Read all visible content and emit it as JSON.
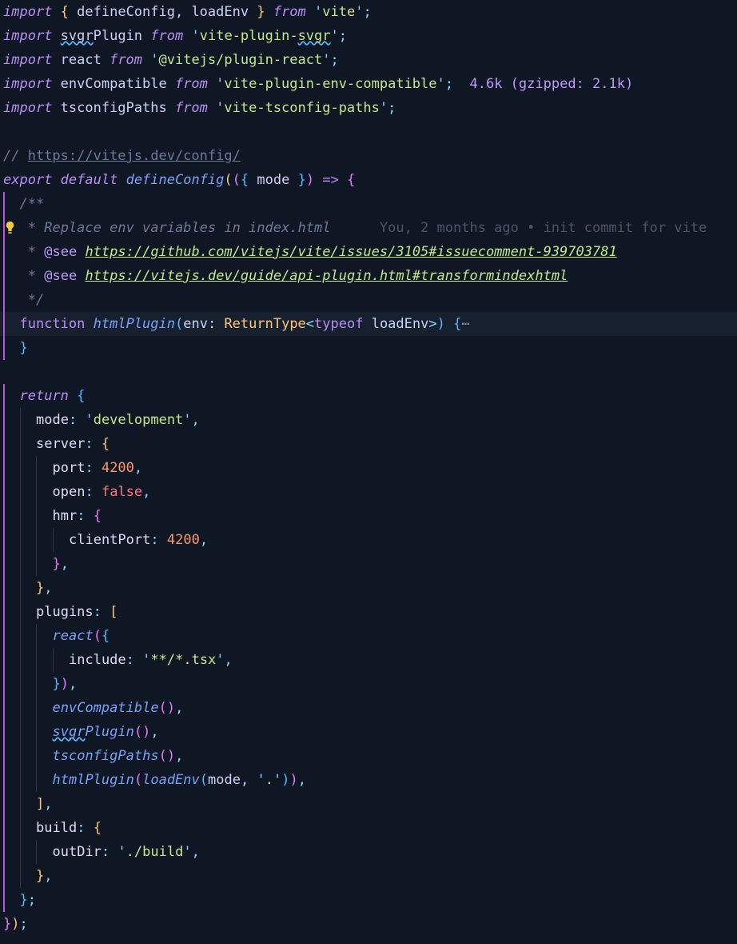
{
  "editor": {
    "lines": [
      [
        [
          "kw",
          "import"
        ],
        [
          "id",
          " "
        ],
        [
          "br1",
          "{"
        ],
        [
          "id",
          " defineConfig, loadEnv "
        ],
        [
          "br1",
          "}"
        ],
        [
          "id",
          " "
        ],
        [
          "kw",
          "from"
        ],
        [
          "id",
          " "
        ],
        [
          "strq",
          "'"
        ],
        [
          "str",
          "vite"
        ],
        [
          "strq",
          "'"
        ],
        [
          "punc",
          ";"
        ]
      ],
      [
        [
          "kw",
          "import"
        ],
        [
          "id",
          " "
        ],
        [
          "id:squig",
          "svgr"
        ],
        [
          "id",
          "Plugin "
        ],
        [
          "kw",
          "from"
        ],
        [
          "id",
          " "
        ],
        [
          "strq",
          "'"
        ],
        [
          "str",
          "vite-plugin-"
        ],
        [
          "str:squig",
          "svgr"
        ],
        [
          "strq",
          "'"
        ],
        [
          "punc",
          ";"
        ]
      ],
      [
        [
          "kw",
          "import"
        ],
        [
          "id",
          " react "
        ],
        [
          "kw",
          "from"
        ],
        [
          "id",
          " "
        ],
        [
          "strq",
          "'"
        ],
        [
          "str",
          "@vitejs/plugin-react"
        ],
        [
          "strq",
          "'"
        ],
        [
          "punc",
          ";"
        ]
      ],
      [
        [
          "kw",
          "import"
        ],
        [
          "id",
          " envCompatible "
        ],
        [
          "kw",
          "from"
        ],
        [
          "id",
          " "
        ],
        [
          "strq",
          "'"
        ],
        [
          "str",
          "vite-plugin-env-compatible"
        ],
        [
          "strq",
          "'"
        ],
        [
          "punc",
          ";"
        ],
        [
          "id",
          "  "
        ],
        [
          "hint",
          "4.6k (gzipped: 2.1k)"
        ]
      ],
      [
        [
          "kw",
          "import"
        ],
        [
          "id",
          " tsconfigPaths "
        ],
        [
          "kw",
          "from"
        ],
        [
          "id",
          " "
        ],
        [
          "strq",
          "'"
        ],
        [
          "str",
          "vite-tsconfig-paths"
        ],
        [
          "strq",
          "'"
        ],
        [
          "punc",
          ";"
        ]
      ],
      [],
      [
        [
          "cmt",
          "// "
        ],
        [
          "lnk",
          "https://vitejs.dev/config/"
        ]
      ],
      [
        [
          "kw",
          "export"
        ],
        [
          "id",
          " "
        ],
        [
          "kw",
          "default"
        ],
        [
          "id",
          " "
        ],
        [
          "fn",
          "defineConfig"
        ],
        [
          "br1",
          "("
        ],
        [
          "br2",
          "("
        ],
        [
          "br3",
          "{"
        ],
        [
          "id",
          " mode "
        ],
        [
          "br3",
          "}"
        ],
        [
          "br2",
          ")"
        ],
        [
          "id",
          " "
        ],
        [
          "kwn",
          "=>"
        ],
        [
          "id",
          " "
        ],
        [
          "br2",
          "{"
        ]
      ],
      [
        [
          "cmt",
          "/**"
        ]
      ],
      [
        [
          "cmt",
          "* Replace env variables in index.html"
        ],
        [
          "id",
          "      "
        ],
        [
          "blame",
          "You, 2 months ago • init commit for vite"
        ]
      ],
      [
        [
          "cmt",
          "* "
        ],
        [
          "tag",
          "@see"
        ],
        [
          "id",
          " "
        ],
        [
          "url",
          "https://github.com/vitejs/vite/issues/3105#issuecomment-939703781"
        ]
      ],
      [
        [
          "cmt",
          "* "
        ],
        [
          "tag",
          "@see"
        ],
        [
          "id",
          " "
        ],
        [
          "url",
          "https://vitejs.dev/guide/api-plugin.html#transformindexhtml"
        ]
      ],
      [
        [
          "cmt",
          "*/"
        ]
      ],
      [
        [
          "kwn",
          "function"
        ],
        [
          "id",
          " "
        ],
        [
          "fn",
          "htmlPlugin"
        ],
        [
          "br3",
          "("
        ],
        [
          "id",
          "env: "
        ],
        [
          "type",
          "ReturnType"
        ],
        [
          "punc",
          "<"
        ],
        [
          "kwn",
          "typeof"
        ],
        [
          "id",
          " loadEnv"
        ],
        [
          "punc",
          ">"
        ],
        [
          "br3",
          ")"
        ],
        [
          "id",
          " "
        ],
        [
          "br3",
          "{"
        ],
        [
          "fold",
          "⋯"
        ]
      ],
      [
        [
          "br3",
          "}"
        ]
      ],
      [],
      [
        [
          "kw",
          "return"
        ],
        [
          "id",
          " "
        ],
        [
          "br3",
          "{"
        ]
      ],
      [
        [
          "prop",
          "mode"
        ],
        [
          "punc",
          ":"
        ],
        [
          "id",
          " "
        ],
        [
          "strq",
          "'"
        ],
        [
          "str",
          "development"
        ],
        [
          "strq",
          "'"
        ],
        [
          "punc",
          ","
        ]
      ],
      [
        [
          "prop",
          "server"
        ],
        [
          "punc",
          ":"
        ],
        [
          "id",
          " "
        ],
        [
          "br1",
          "{"
        ]
      ],
      [
        [
          "prop",
          "port"
        ],
        [
          "punc",
          ":"
        ],
        [
          "id",
          " "
        ],
        [
          "num",
          "4200"
        ],
        [
          "punc",
          ","
        ]
      ],
      [
        [
          "prop",
          "open"
        ],
        [
          "punc",
          ":"
        ],
        [
          "id",
          " "
        ],
        [
          "bool",
          "false"
        ],
        [
          "punc",
          ","
        ]
      ],
      [
        [
          "prop",
          "hmr"
        ],
        [
          "punc",
          ":"
        ],
        [
          "id",
          " "
        ],
        [
          "br2",
          "{"
        ]
      ],
      [
        [
          "prop",
          "clientPort"
        ],
        [
          "punc",
          ":"
        ],
        [
          "id",
          " "
        ],
        [
          "num",
          "4200"
        ],
        [
          "punc",
          ","
        ]
      ],
      [
        [
          "br2",
          "}"
        ],
        [
          "punc",
          ","
        ]
      ],
      [
        [
          "br1",
          "}"
        ],
        [
          "punc",
          ","
        ]
      ],
      [
        [
          "prop",
          "plugins"
        ],
        [
          "punc",
          ":"
        ],
        [
          "id",
          " "
        ],
        [
          "br1",
          "["
        ]
      ],
      [
        [
          "fn",
          "react"
        ],
        [
          "br2",
          "("
        ],
        [
          "br3",
          "{"
        ]
      ],
      [
        [
          "prop",
          "include"
        ],
        [
          "punc",
          ":"
        ],
        [
          "id",
          " "
        ],
        [
          "strq",
          "'"
        ],
        [
          "str",
          "**/*.tsx"
        ],
        [
          "strq",
          "'"
        ],
        [
          "punc",
          ","
        ]
      ],
      [
        [
          "br3",
          "}"
        ],
        [
          "br2",
          ")"
        ],
        [
          "punc",
          ","
        ]
      ],
      [
        [
          "fn",
          "envCompatible"
        ],
        [
          "br2",
          "("
        ],
        [
          "br2",
          ")"
        ],
        [
          "punc",
          ","
        ]
      ],
      [
        [
          "fn:squig",
          "svgr"
        ],
        [
          "fn",
          "Plugin"
        ],
        [
          "br2",
          "("
        ],
        [
          "br2",
          ")"
        ],
        [
          "punc",
          ","
        ]
      ],
      [
        [
          "fn",
          "tsconfigPaths"
        ],
        [
          "br2",
          "("
        ],
        [
          "br2",
          ")"
        ],
        [
          "punc",
          ","
        ]
      ],
      [
        [
          "fn",
          "htmlPlugin"
        ],
        [
          "br2",
          "("
        ],
        [
          "fn",
          "loadEnv"
        ],
        [
          "br3",
          "("
        ],
        [
          "id",
          "mode, "
        ],
        [
          "strq",
          "'"
        ],
        [
          "str",
          "."
        ],
        [
          "strq",
          "'"
        ],
        [
          "br3",
          ")"
        ],
        [
          "br2",
          ")"
        ],
        [
          "punc",
          ","
        ]
      ],
      [
        [
          "br1",
          "]"
        ],
        [
          "punc",
          ","
        ]
      ],
      [
        [
          "prop",
          "build"
        ],
        [
          "punc",
          ":"
        ],
        [
          "id",
          " "
        ],
        [
          "br1",
          "{"
        ]
      ],
      [
        [
          "prop",
          "outDir"
        ],
        [
          "punc",
          ":"
        ],
        [
          "id",
          " "
        ],
        [
          "strq",
          "'"
        ],
        [
          "str",
          "./build"
        ],
        [
          "strq",
          "'"
        ],
        [
          "punc",
          ","
        ]
      ],
      [
        [
          "br1",
          "}"
        ],
        [
          "punc",
          ","
        ]
      ],
      [
        [
          "br3",
          "}"
        ],
        [
          "punc",
          ";"
        ]
      ],
      [
        [
          "br2",
          "}"
        ],
        [
          "br1",
          ")"
        ],
        [
          "punc",
          ";"
        ]
      ]
    ]
  }
}
